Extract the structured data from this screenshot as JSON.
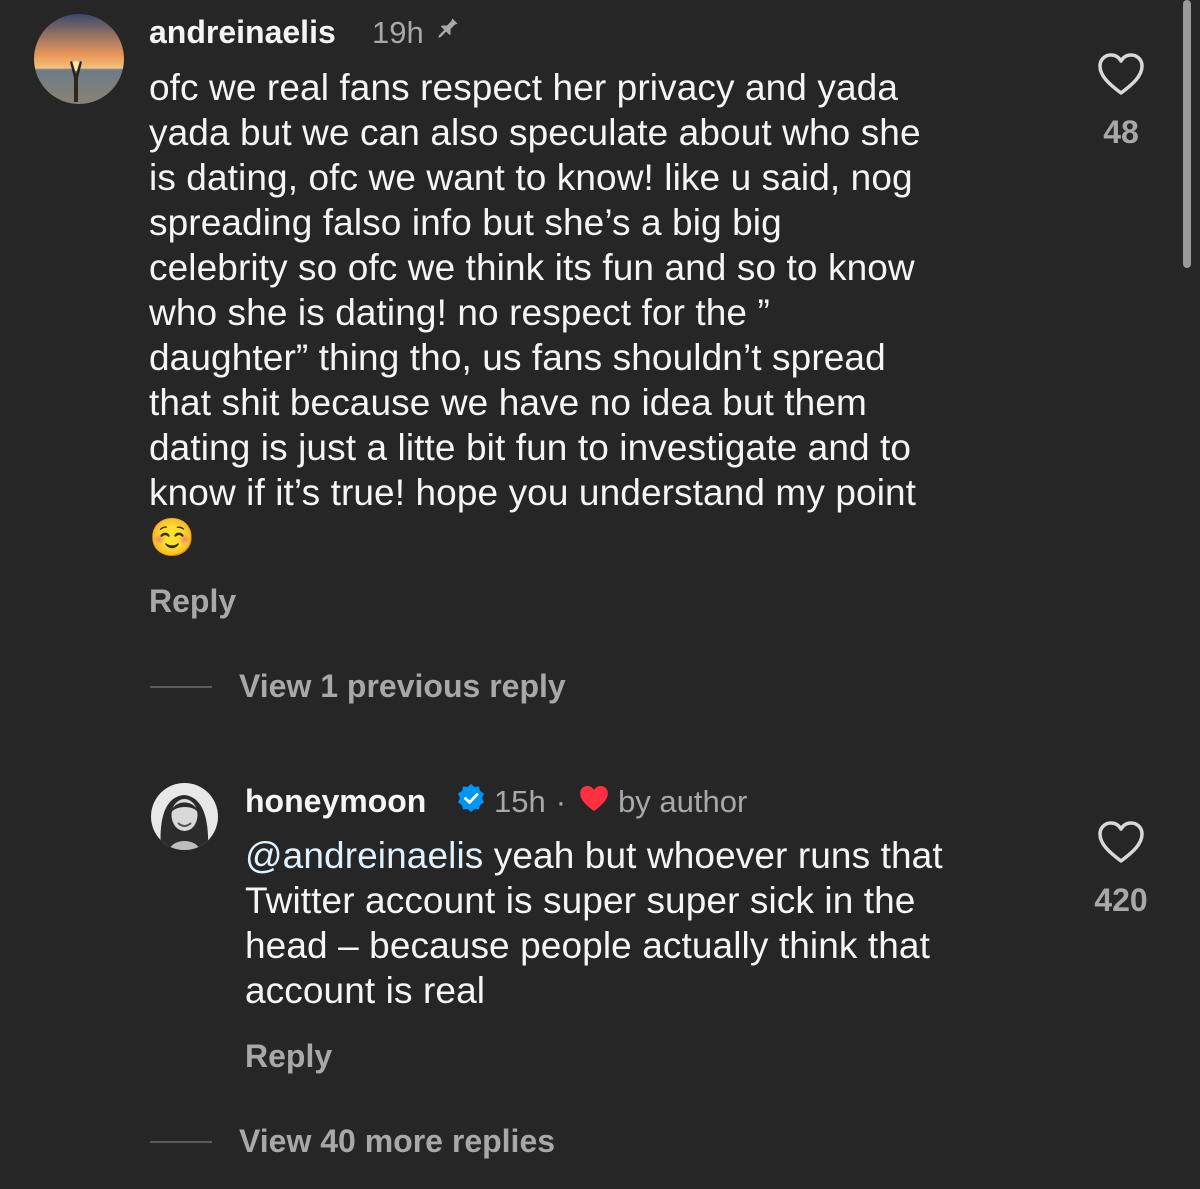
{
  "comment": {
    "username": "andreinaelis",
    "time": "19h",
    "text": "ofc we real fans respect her privacy and yada\nyada but we can also speculate about who she\nis dating, ofc we want to know! like u said, nog\nspreading falso info but she’s a big big\ncelebrity so ofc we think its fun and so to know\nwho she is dating! no respect for the ”\ndaughter” thing tho, us fans shouldn’t spread\nthat shit because we have no idea but them\ndating is just a litte bit fun to investigate and to\nknow if it’s true! hope you understand my point\n☺️",
    "reply_label": "Reply",
    "like_count": "48"
  },
  "view_previous": "View 1 previous reply",
  "reply": {
    "username": "honeymoon",
    "time": "15h",
    "dot": "·",
    "by_author": "by author",
    "mention": "@andreinaelis",
    "text": " yeah but whoever runs that\nTwitter account is super super sick in the\nhead – because people actually think that\naccount is real",
    "reply_label": "Reply",
    "like_count": "420"
  },
  "view_more": "View 40 more replies",
  "colors": {
    "background": "#262626",
    "secondary_text": "#a8a8a8",
    "verified_blue": "#0095f6",
    "author_heart": "#ff3040"
  },
  "icons": {
    "pin": "pin-icon",
    "heart": "heart-outline-icon",
    "verified": "verified-badge-icon"
  }
}
